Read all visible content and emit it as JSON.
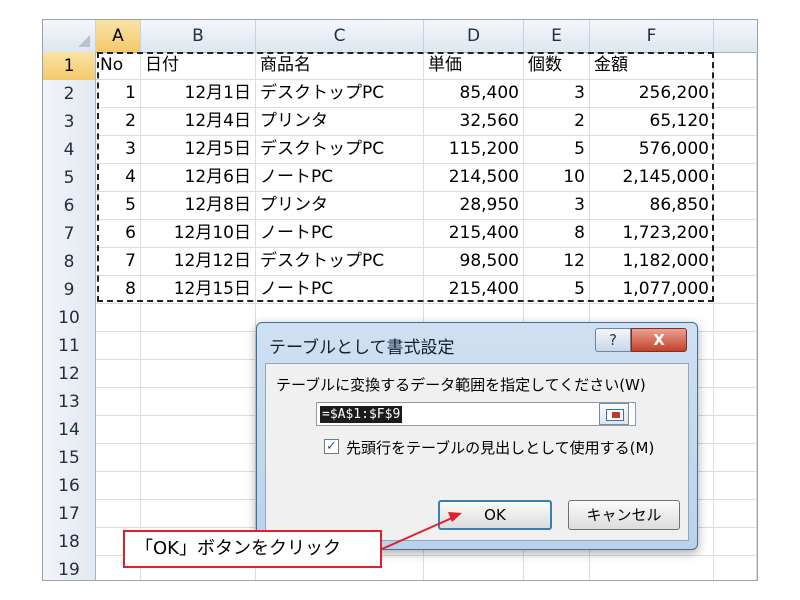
{
  "columns": [
    "A",
    "B",
    "C",
    "D",
    "E",
    "F"
  ],
  "rows": [
    {
      "num": "1",
      "cells": [
        "No",
        "日付",
        "商品名",
        "単価",
        "個数",
        "金額"
      ]
    },
    {
      "num": "2",
      "cells": [
        "1",
        "12月1日",
        "デスクトップPC",
        "85,400",
        "3",
        "256,200"
      ]
    },
    {
      "num": "3",
      "cells": [
        "2",
        "12月4日",
        "プリンタ",
        "32,560",
        "2",
        "65,120"
      ]
    },
    {
      "num": "4",
      "cells": [
        "3",
        "12月5日",
        "デスクトップPC",
        "115,200",
        "5",
        "576,000"
      ]
    },
    {
      "num": "5",
      "cells": [
        "4",
        "12月6日",
        "ノートPC",
        "214,500",
        "10",
        "2,145,000"
      ]
    },
    {
      "num": "6",
      "cells": [
        "5",
        "12月8日",
        "プリンタ",
        "28,950",
        "3",
        "86,850"
      ]
    },
    {
      "num": "7",
      "cells": [
        "6",
        "12月10日",
        "ノートPC",
        "215,400",
        "8",
        "1,723,200"
      ]
    },
    {
      "num": "8",
      "cells": [
        "7",
        "12月12日",
        "デスクトップPC",
        "98,500",
        "12",
        "1,182,000"
      ]
    },
    {
      "num": "9",
      "cells": [
        "8",
        "12月15日",
        "ノートPC",
        "215,400",
        "5",
        "1,077,000"
      ]
    },
    {
      "num": "10",
      "cells": [
        "",
        "",
        "",
        "",
        "",
        ""
      ]
    },
    {
      "num": "11",
      "cells": [
        "",
        "",
        "",
        "",
        "",
        ""
      ]
    },
    {
      "num": "12",
      "cells": [
        "",
        "",
        "",
        "",
        "",
        ""
      ]
    },
    {
      "num": "13",
      "cells": [
        "",
        "",
        "",
        "",
        "",
        ""
      ]
    },
    {
      "num": "14",
      "cells": [
        "",
        "",
        "",
        "",
        "",
        ""
      ]
    },
    {
      "num": "15",
      "cells": [
        "",
        "",
        "",
        "",
        "",
        ""
      ]
    },
    {
      "num": "16",
      "cells": [
        "",
        "",
        "",
        "",
        "",
        ""
      ]
    },
    {
      "num": "17",
      "cells": [
        "",
        "",
        "",
        "",
        "",
        ""
      ]
    },
    {
      "num": "18",
      "cells": [
        "",
        "",
        "",
        "",
        "",
        ""
      ]
    },
    {
      "num": "19",
      "cells": [
        "",
        "",
        "",
        "",
        "",
        ""
      ]
    }
  ],
  "dialog": {
    "title": "テーブルとして書式設定",
    "help_label": "?",
    "close_label": "X",
    "range_label": "テーブルに変換するデータ範囲を指定してください(W)",
    "range_value": "=$A$1:$F$9",
    "checkbox_label": "先頭行をテーブルの見出しとして使用する(M)",
    "checkbox_checked": true,
    "checkbox_mark": "✓",
    "ok_label": "OK",
    "cancel_label": "キャンセル"
  },
  "callout": {
    "text": "「OK」ボタンをクリック"
  },
  "colors": {
    "callout_border": "#e0202a",
    "active_header": "#f4c96b",
    "dialog_frame": "#b9d2ea"
  }
}
